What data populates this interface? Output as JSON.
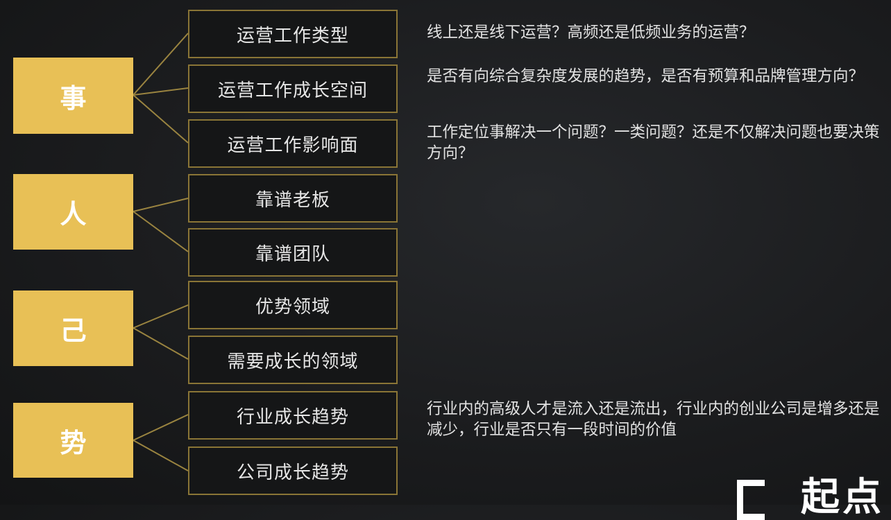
{
  "categories": [
    {
      "label": "事",
      "items": [
        "运营工作类型",
        "运营工作成长空间",
        "运营工作影响面"
      ]
    },
    {
      "label": "人",
      "items": [
        "靠谱老板",
        "靠谱团队"
      ]
    },
    {
      "label": "己",
      "items": [
        "优势领域",
        "需要成长的领域"
      ]
    },
    {
      "label": "势",
      "items": [
        "行业成长趋势",
        "公司成长趋势"
      ]
    }
  ],
  "notes": [
    "线上还是线下运营？高频还是低频业务的运营？",
    "是否有向综合复杂度发展的趋势，是否有预算和品牌管理方向？",
    "工作定位事解决一个问题？一类问题？还是不仅解决问题也要决策方向？",
    "行业内的高级人才是流入还是流出，行业内的创业公司是增多还是减少，行业是否只有一段时间的价值"
  ],
  "logo": {
    "text": "起点"
  },
  "colors": {
    "accent": "#e8c056",
    "connector": "#9a8440",
    "border": "#8a7536",
    "background": "#1b1c1e"
  }
}
